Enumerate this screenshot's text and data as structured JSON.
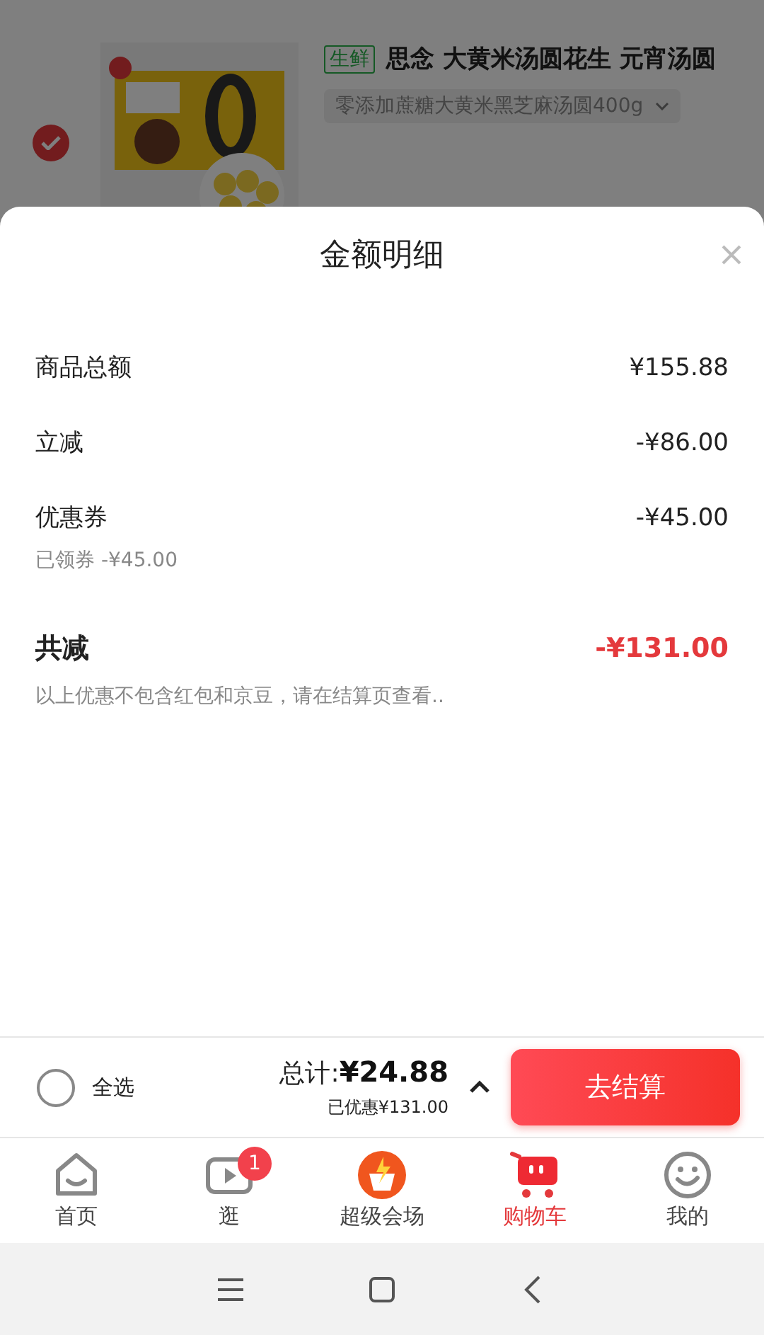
{
  "product": {
    "checked": true,
    "tag": "生鲜",
    "title": "思念 大黄米汤圆花生 元宵汤圆",
    "variant": "零添加蔗糖大黄米黑芝麻汤圆400g"
  },
  "sheet": {
    "title": "金额明细",
    "rows": [
      {
        "label": "商品总额",
        "amount": "¥155.88"
      },
      {
        "label": "立减",
        "amount": "-¥86.00"
      },
      {
        "label": "优惠券",
        "amount": "-¥45.00",
        "sub": "已领券 -¥45.00"
      }
    ],
    "total": {
      "label": "共减",
      "amount": "-¥131.00"
    },
    "note": "以上优惠不包含红包和京豆，请在结算页查看.."
  },
  "checkout": {
    "select_all": {
      "label": "全选",
      "checked": false
    },
    "total_label": "总计:",
    "total_amount": "¥24.88",
    "saved": "已优惠¥131.00",
    "button": "去结算"
  },
  "tabs": [
    {
      "kind": "home",
      "label": "首页",
      "selected": false
    },
    {
      "kind": "video",
      "label": "逛",
      "selected": false,
      "badge": "1"
    },
    {
      "kind": "venue",
      "label": "超级会场",
      "selected": false
    },
    {
      "kind": "cart",
      "label": "购物车",
      "selected": true
    },
    {
      "kind": "me",
      "label": "我的",
      "selected": false
    }
  ]
}
